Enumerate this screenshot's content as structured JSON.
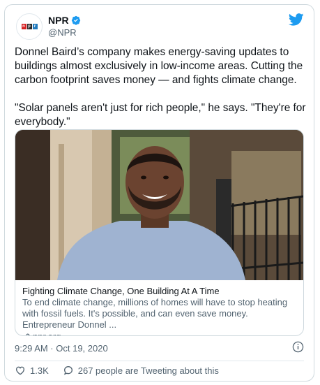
{
  "author": {
    "name": "NPR",
    "handle": "@NPR",
    "logo_letters": [
      "n",
      "p",
      "r"
    ]
  },
  "tweet": {
    "text": "Donnel Baird’s company makes energy-saving updates to buildings almost exclusively in low-income areas. Cutting the carbon footprint saves money — and fights climate change.\n\n\"Solar panels aren't just for rich people,\" he says. \"They're for everybody.\""
  },
  "link_card": {
    "title": "Fighting Climate Change, One Building At A Time",
    "description": "To end climate change, millions of homes will have to stop heating with fossil fuels. It's possible, and can even save money. Entrepreneur Donnel ...",
    "domain": "npr.org"
  },
  "timestamp": "9:29 AM · Oct 19, 2020",
  "actions": {
    "likes": "1.3K",
    "talking": "267 people are Tweeting about this"
  },
  "colors": {
    "twitter_blue": "#1d9bf0",
    "text_secondary": "#536471",
    "border": "#cfd9de"
  },
  "icons": [
    "verified-badge-icon",
    "twitter-bird-icon",
    "info-icon",
    "heart-icon",
    "comment-icon",
    "link-icon"
  ]
}
